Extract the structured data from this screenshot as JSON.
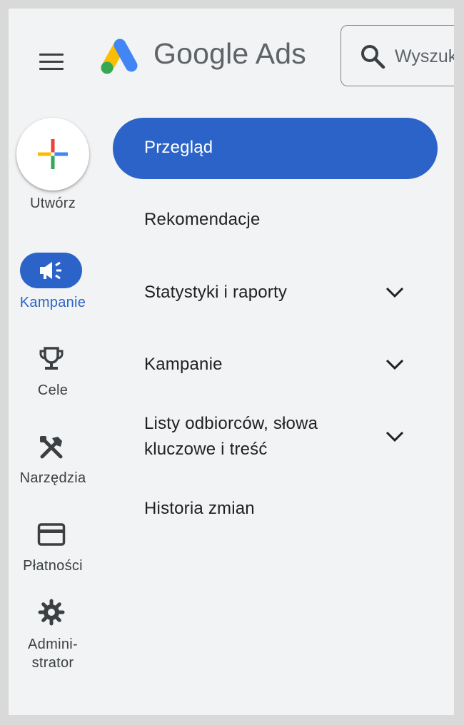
{
  "header": {
    "brand": "Google Ads",
    "search_placeholder": "Wyszukaj"
  },
  "rail": {
    "create_label": "Utwórz",
    "items": [
      {
        "label": "Kampanie",
        "icon": "megaphone-icon",
        "active": true
      },
      {
        "label": "Cele",
        "icon": "trophy-icon"
      },
      {
        "label": "Narzędzia",
        "icon": "tools-icon"
      },
      {
        "label": "Płatności",
        "icon": "credit-card-icon"
      },
      {
        "label": "Admini-",
        "label2": "strator",
        "icon": "gear-icon"
      }
    ]
  },
  "menu": {
    "active": "Przegląd",
    "items": [
      {
        "label": "Rekomendacje"
      },
      {
        "label": "Statystyki i raporty",
        "expandable": true
      },
      {
        "label": "Kampanie",
        "expandable": true
      },
      {
        "label": "Listy odbiorców, słowa",
        "label2": "kluczowe i treść",
        "expandable": true
      },
      {
        "label": "Historia zmian"
      }
    ]
  },
  "colors": {
    "accent": "#2c63c9",
    "background": "#f1f3f4",
    "text": "#202124",
    "icon": "#3c4043"
  }
}
